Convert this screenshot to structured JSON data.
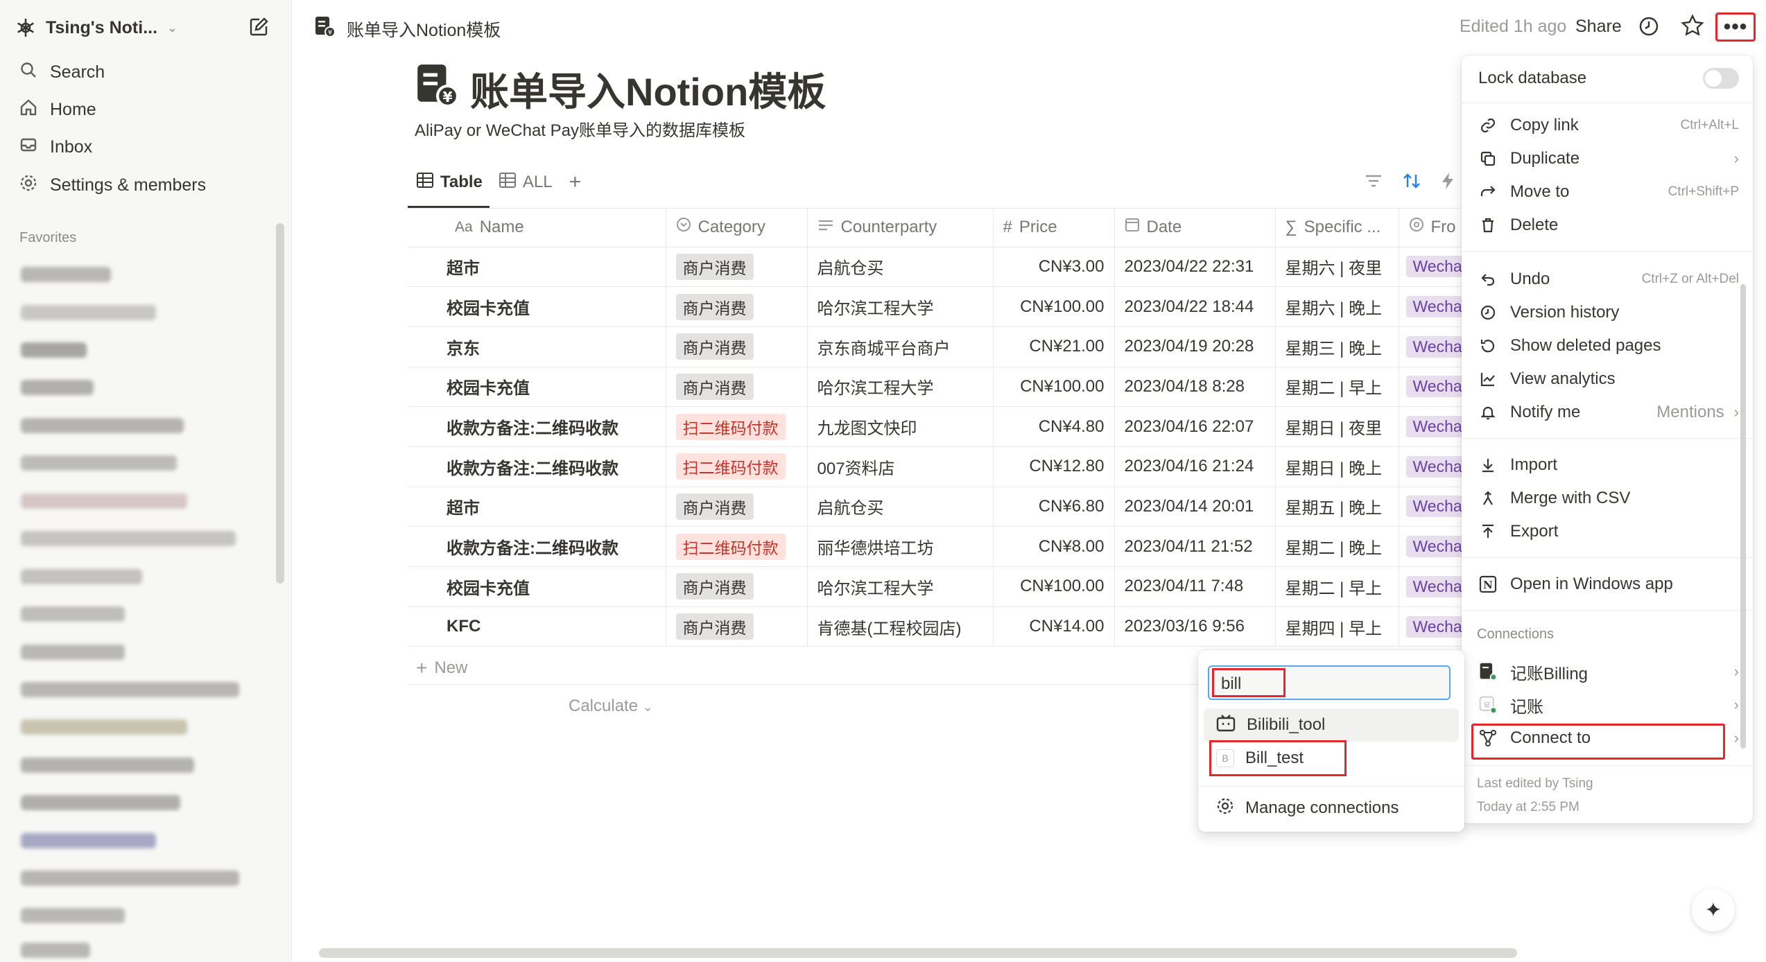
{
  "sidebar": {
    "workspace": "Tsing's Noti...",
    "nav": [
      "Search",
      "Home",
      "Inbox",
      "Settings & members"
    ],
    "favorites_label": "Favorites"
  },
  "topbar": {
    "page_title": "账单导入Notion模板",
    "edited": "Edited 1h ago",
    "share": "Share",
    "more": "•••"
  },
  "page": {
    "title": "账单导入Notion模板",
    "description": "AliPay or WeChat Pay账单导入的数据库模板"
  },
  "views": {
    "tabs": [
      "Table",
      "ALL"
    ],
    "add": "+"
  },
  "table": {
    "columns": [
      "Name",
      "Category",
      "Counterparty",
      "Price",
      "Date",
      "Specific ...",
      "Fro"
    ],
    "column_icons": [
      "Aa",
      "category-icon",
      "text-icon",
      "#",
      "calendar-icon",
      "sigma-icon",
      "status-icon"
    ],
    "rows": [
      [
        "超市",
        "商户消费",
        "启航仓买",
        "CN¥3.00",
        "2023/04/22 22:31",
        "星期六 | 夜里",
        "Wecha"
      ],
      [
        "校园卡充值",
        "商户消费",
        "哈尔滨工程大学",
        "CN¥100.00",
        "2023/04/22 18:44",
        "星期六 | 晚上",
        "Wecha"
      ],
      [
        "京东",
        "商户消费",
        "京东商城平台商户",
        "CN¥21.00",
        "2023/04/19 20:28",
        "星期三 | 晚上",
        "Wecha"
      ],
      [
        "校园卡充值",
        "商户消费",
        "哈尔滨工程大学",
        "CN¥100.00",
        "2023/04/18 8:28",
        "星期二 | 早上",
        "Wecha"
      ],
      [
        "收款方备注:二维码收款",
        "扫二维码付款",
        "九龙图文快印",
        "CN¥4.80",
        "2023/04/16 22:07",
        "星期日 | 夜里",
        "Wecha"
      ],
      [
        "收款方备注:二维码收款",
        "扫二维码付款",
        "007资料店",
        "CN¥12.80",
        "2023/04/16 21:24",
        "星期日 | 晚上",
        "Wecha"
      ],
      [
        "超市",
        "商户消费",
        "启航仓买",
        "CN¥6.80",
        "2023/04/14 20:01",
        "星期五 | 晚上",
        "Wecha"
      ],
      [
        "收款方备注:二维码收款",
        "扫二维码付款",
        "丽华德烘培工坊",
        "CN¥8.00",
        "2023/04/11 21:52",
        "星期二 | 晚上",
        "Wecha"
      ],
      [
        "校园卡充值",
        "商户消费",
        "哈尔滨工程大学",
        "CN¥100.00",
        "2023/04/11 7:48",
        "星期二 | 早上",
        "Wecha"
      ],
      [
        "KFC",
        "商户消费",
        "肯德基(工程校园店)",
        "CN¥14.00",
        "2023/03/16 9:56",
        "星期四 | 早上",
        "Wecha"
      ]
    ],
    "new_label": "New",
    "calculate_label": "Calculate"
  },
  "menu": {
    "lock": "Lock database",
    "items1": [
      {
        "label": "Copy link",
        "shortcut": "Ctrl+Alt+L",
        "icon": "link-icon"
      },
      {
        "label": "Duplicate",
        "shortcut": "",
        "icon": "duplicate-icon"
      },
      {
        "label": "Move to",
        "shortcut": "Ctrl+Shift+P",
        "icon": "move-icon"
      },
      {
        "label": "Delete",
        "shortcut": "",
        "icon": "trash-icon"
      }
    ],
    "items2": [
      {
        "label": "Undo",
        "shortcut": "Ctrl+Z or Alt+Del",
        "icon": "undo-icon"
      },
      {
        "label": "Version history",
        "shortcut": "",
        "icon": "clock-icon"
      },
      {
        "label": "Show deleted pages",
        "shortcut": "",
        "icon": "restore-icon"
      },
      {
        "label": "View analytics",
        "shortcut": "",
        "icon": "analytics-icon"
      },
      {
        "label": "Notify me",
        "shortcut": "Mentions",
        "icon": "bell-icon"
      }
    ],
    "items3": [
      {
        "label": "Import",
        "icon": "import-icon"
      },
      {
        "label": "Merge with CSV",
        "icon": "merge-icon"
      },
      {
        "label": "Export",
        "icon": "export-icon"
      }
    ],
    "open_app": "Open in Windows app",
    "connections_label": "Connections",
    "connections": [
      "记账Billing",
      "记账"
    ],
    "connect_to": "Connect to",
    "last_edited": "Last edited by Tsing",
    "last_edited_time": "Today at 2:55 PM"
  },
  "connect_popup": {
    "query": "bill",
    "results": [
      "Bilibili_tool",
      "Bill_test"
    ],
    "manage": "Manage connections"
  }
}
